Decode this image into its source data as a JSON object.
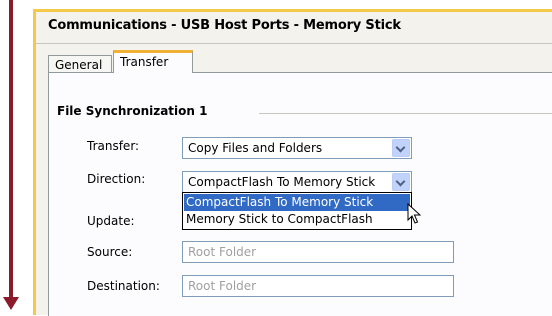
{
  "window": {
    "title": "Communications - USB Host Ports - Memory Stick"
  },
  "tabs": [
    {
      "label": "General",
      "active": false
    },
    {
      "label": "Transfer",
      "active": true
    }
  ],
  "section": {
    "title": "File Synchronization 1"
  },
  "form": {
    "transfer": {
      "label": "Transfer:",
      "value": "Copy Files and Folders"
    },
    "direction": {
      "label": "Direction:",
      "value": "CompactFlash To Memory Stick",
      "options": [
        "CompactFlash To Memory Stick",
        "Memory Stick to CompactFlash"
      ],
      "highlighted_option": "CompactFlash To Memory Stick"
    },
    "update": {
      "label": "Update:"
    },
    "source": {
      "label": "Source:",
      "placeholder": "Root Folder"
    },
    "destination": {
      "label": "Destination:",
      "placeholder": "Root Folder"
    }
  },
  "colors": {
    "accent_arrow": "#8b1a2b",
    "panel_border": "#f3c94a",
    "selection": "#316ac5",
    "tab_highlight": "#f0b033"
  },
  "icons": [
    "arrow-down-icon",
    "chevron-down-icon",
    "mouse-pointer-icon"
  ]
}
